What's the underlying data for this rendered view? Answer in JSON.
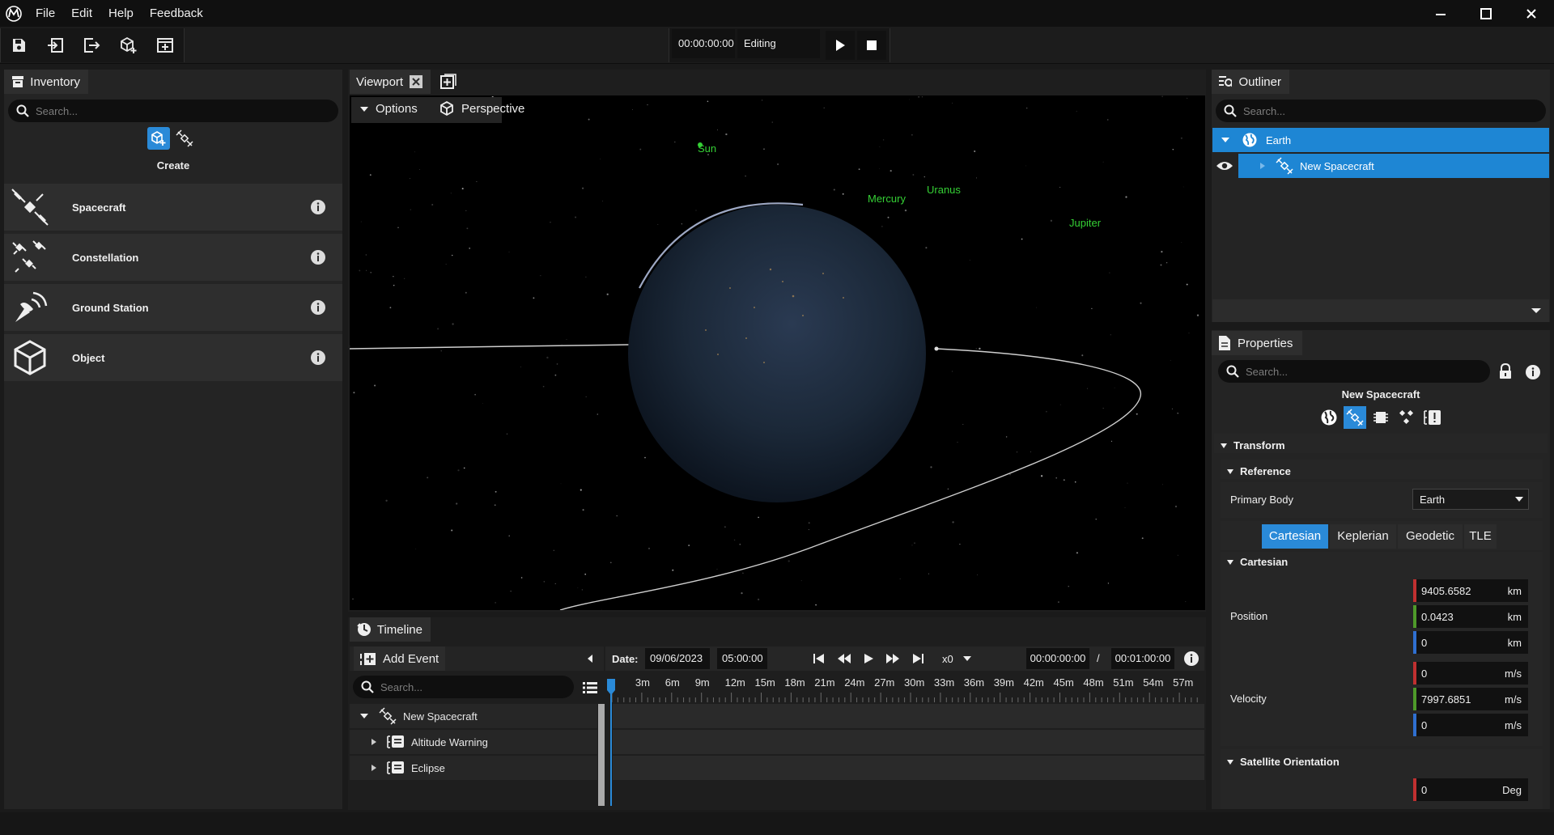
{
  "menu": [
    "File",
    "Edit",
    "Help",
    "Feedback"
  ],
  "toolbar": {
    "time": "00:00:00:00",
    "mode": "Editing"
  },
  "inventory": {
    "title": "Inventory",
    "search_placeholder": "Search...",
    "create_label": "Create",
    "items": [
      {
        "label": "Spacecraft",
        "icon": "satellite-icon"
      },
      {
        "label": "Constellation",
        "icon": "constellation-icon"
      },
      {
        "label": "Ground Station",
        "icon": "antenna-icon"
      },
      {
        "label": "Object",
        "icon": "cube-icon"
      }
    ]
  },
  "viewport": {
    "title": "Viewport",
    "options_label": "Options",
    "camera_label": "Perspective",
    "planets": [
      "Sun",
      "Mercury",
      "Uranus",
      "Jupiter"
    ]
  },
  "timeline": {
    "title": "Timeline",
    "add_event_label": "Add Event",
    "search_placeholder": "Search...",
    "date_label": "Date:",
    "date_value": "09/06/2023",
    "time_value": "05:00:00",
    "speed": "x0",
    "current_time": "00:00:00:00",
    "separator": "/",
    "end_time": "00:01:00:00",
    "ticks": [
      "3m",
      "6m",
      "9m",
      "12m",
      "15m",
      "18m",
      "21m",
      "24m",
      "27m",
      "30m",
      "33m",
      "36m",
      "39m",
      "42m",
      "45m",
      "48m",
      "51m",
      "54m",
      "57m"
    ],
    "tree": [
      {
        "label": "New Spacecraft",
        "level": 0
      },
      {
        "label": "Altitude Warning",
        "level": 1
      },
      {
        "label": "Eclipse",
        "level": 1
      }
    ]
  },
  "outliner": {
    "title": "Outliner",
    "search_placeholder": "Search...",
    "tree": [
      {
        "label": "Earth"
      },
      {
        "label": "New Spacecraft"
      }
    ]
  },
  "properties": {
    "title": "Properties",
    "search_placeholder": "Search...",
    "object_name": "New Spacecraft",
    "transform_label": "Transform",
    "reference_label": "Reference",
    "primary_body_label": "Primary Body",
    "primary_body_value": "Earth",
    "tabs": [
      "Cartesian",
      "Keplerian",
      "Geodetic",
      "TLE"
    ],
    "cartesian_label": "Cartesian",
    "position_label": "Position",
    "position": [
      {
        "value": "9405.6582",
        "unit": "km",
        "color": "#c03030"
      },
      {
        "value": "0.0423",
        "unit": "km",
        "color": "#4e9a2a"
      },
      {
        "value": "0",
        "unit": "km",
        "color": "#2f6fd0"
      }
    ],
    "velocity_label": "Velocity",
    "velocity": [
      {
        "value": "0",
        "unit": "m/s",
        "color": "#c03030"
      },
      {
        "value": "7997.6851",
        "unit": "m/s",
        "color": "#4e9a2a"
      },
      {
        "value": "0",
        "unit": "m/s",
        "color": "#2f6fd0"
      }
    ],
    "orientation_label": "Satellite Orientation",
    "orientation": [
      {
        "value": "0",
        "unit": "Deg",
        "color": "#c03030"
      }
    ]
  },
  "colors": {
    "accent": "#2a8ad8",
    "selected_row": "#1e86d4",
    "planet_label": "#35d035"
  }
}
